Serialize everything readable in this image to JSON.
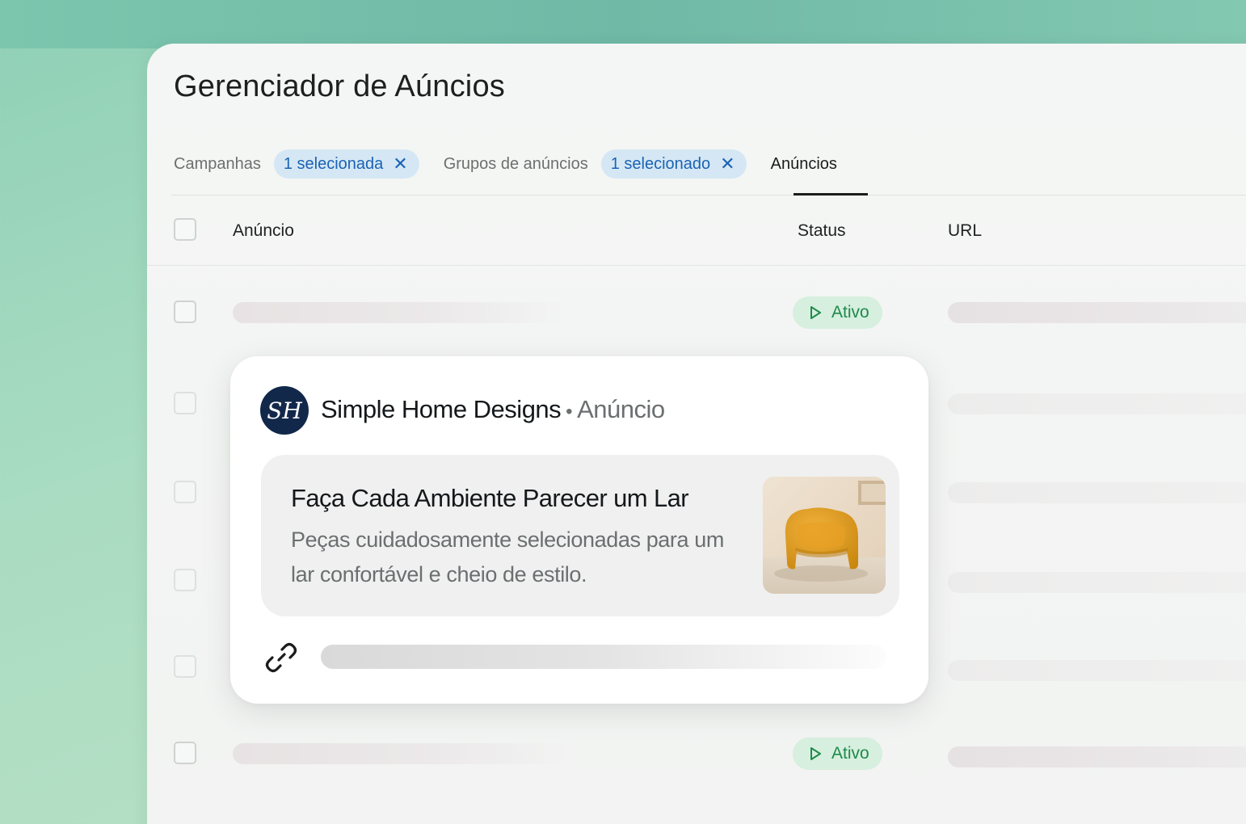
{
  "window": {
    "title": "Gerenciador de Aúncios"
  },
  "tabs": {
    "campaigns_label": "Campanhas",
    "campaigns_chip": "1 selecionada",
    "adgroups_label": "Grupos de anúncios",
    "adgroups_chip": "1 selecionado",
    "ads_label": "Anúncios",
    "chip_close_icon": "close-icon"
  },
  "table": {
    "columns": [
      "Anúncio",
      "Status",
      "URL"
    ],
    "rows": [
      {
        "status": "Ativo"
      },
      {
        "status": ""
      },
      {
        "status": ""
      },
      {
        "status": ""
      },
      {
        "status": ""
      },
      {
        "status": "Ativo"
      }
    ]
  },
  "ad_preview": {
    "avatar_initials": "SH",
    "advertiser": "Simple Home Designs",
    "separator": "•",
    "kind": "Anúncio",
    "headline": "Faça Cada Ambiente Parecer um Lar",
    "description": "Peças cuidadosamente selecionadas para um lar confortável e cheio de estilo.",
    "image_icon": "armchair-image",
    "link_icon": "link-icon"
  },
  "colors": {
    "chip_bg": "#d5e7f4",
    "chip_text": "#1b63b3",
    "status_bg": "#d6efdf",
    "status_text": "#1f8a4a",
    "avatar_bg": "#12284a"
  }
}
